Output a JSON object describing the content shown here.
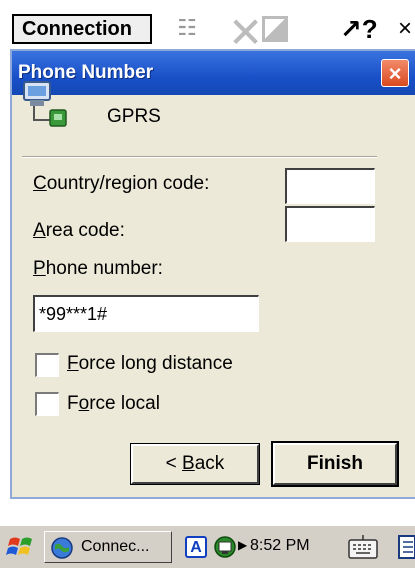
{
  "top_window": {
    "button_label": "Connection"
  },
  "dialog": {
    "title": "Phone Number",
    "connection_name": "GPRS",
    "country_label": "Country/region code:",
    "country_value": "",
    "area_label": "Area code:",
    "area_value": "",
    "phone_label": "Phone number:",
    "phone_value": "*99***1#",
    "force_long_label": "Force long distance",
    "force_long_checked": false,
    "force_local_label": "Force local",
    "force_local_checked": false,
    "back_label": "< Back",
    "finish_label": "Finish"
  },
  "taskbar": {
    "task_label": "Connec...",
    "clock": "8:52 PM",
    "tray_input": "A"
  },
  "colors": {
    "titlebar": "#1950c8",
    "dialog_bg": "#ece9d8",
    "close": "#d94a20"
  }
}
